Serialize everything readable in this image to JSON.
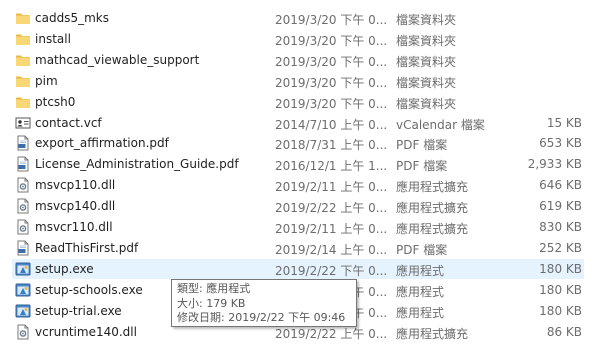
{
  "files": [
    {
      "name": "cadds5_mks",
      "date": "2019/3/20 下午 0...",
      "type": "檔案資料夾",
      "size": "",
      "icon": "folder-icon"
    },
    {
      "name": "install",
      "date": "2019/3/20 下午 0...",
      "type": "檔案資料夾",
      "size": "",
      "icon": "folder-icon"
    },
    {
      "name": "mathcad_viewable_support",
      "date": "2019/3/20 下午 0...",
      "type": "檔案資料夾",
      "size": "",
      "icon": "folder-icon"
    },
    {
      "name": "pim",
      "date": "2019/3/20 下午 0...",
      "type": "檔案資料夾",
      "size": "",
      "icon": "folder-icon"
    },
    {
      "name": "ptcsh0",
      "date": "2019/3/20 下午 0...",
      "type": "檔案資料夾",
      "size": "",
      "icon": "folder-icon"
    },
    {
      "name": "contact.vcf",
      "date": "2014/7/10 上午 0...",
      "type": "vCalendar 檔案",
      "size": "15 KB",
      "icon": "vcard-icon"
    },
    {
      "name": "export_affirmation.pdf",
      "date": "2018/7/31 上午 0...",
      "type": "PDF 檔案",
      "size": "653 KB",
      "icon": "pdf-icon"
    },
    {
      "name": "License_Administration_Guide.pdf",
      "date": "2016/12/1 上午 1...",
      "type": "PDF 檔案",
      "size": "2,933 KB",
      "icon": "pdf-icon"
    },
    {
      "name": "msvcp110.dll",
      "date": "2019/2/11 上午 0...",
      "type": "應用程式擴充",
      "size": "646 KB",
      "icon": "dll-icon"
    },
    {
      "name": "msvcp140.dll",
      "date": "2019/2/22 上午 0...",
      "type": "應用程式擴充",
      "size": "619 KB",
      "icon": "dll-icon"
    },
    {
      "name": "msvcr110.dll",
      "date": "2019/2/11 上午 0...",
      "type": "應用程式擴充",
      "size": "830 KB",
      "icon": "dll-icon"
    },
    {
      "name": "ReadThisFirst.pdf",
      "date": "2019/2/14 上午 0...",
      "type": "PDF 檔案",
      "size": "252 KB",
      "icon": "pdf-icon"
    },
    {
      "name": "setup.exe",
      "date": "2019/2/22 下午 0...",
      "type": "應用程式",
      "size": "180 KB",
      "icon": "exe-icon"
    },
    {
      "name": "setup-schools.exe",
      "date": "2019/2/22 下午 0...",
      "type": "應用程式",
      "size": "180 KB",
      "icon": "exe-icon"
    },
    {
      "name": "setup-trial.exe",
      "date": "2019/2/22 下午 0...",
      "type": "應用程式",
      "size": "180 KB",
      "icon": "exe-icon"
    },
    {
      "name": "vcruntime140.dll",
      "date": "2019/2/22 上午 0...",
      "type": "應用程式擴充",
      "size": "86 KB",
      "icon": "dll-icon"
    }
  ],
  "hovered_index": 12,
  "tooltip": {
    "type_line": "類型: 應用程式",
    "size_line": "大小: 179 KB",
    "date_line": "修改日期: 2019/2/22 下午 09:46"
  },
  "colors": {
    "hover_bg": "#e5f3ff",
    "folder": "#f8d775",
    "pdf_accent": "#3a6fb0"
  }
}
